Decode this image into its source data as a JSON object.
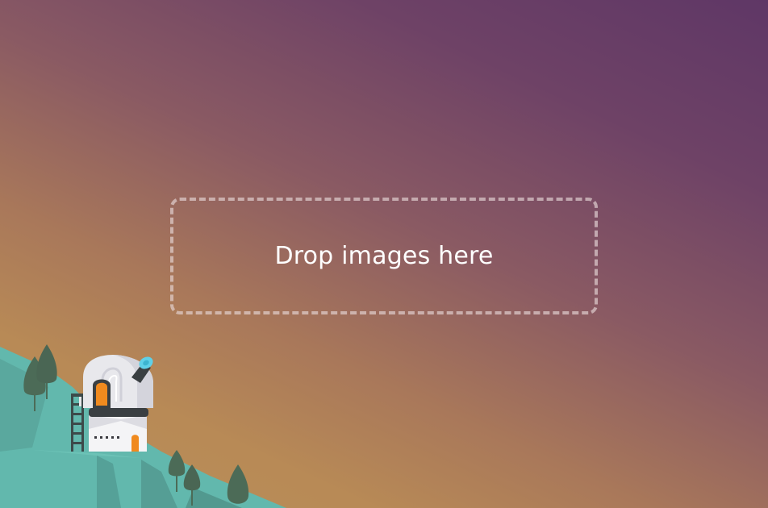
{
  "dropzone": {
    "label": "Drop images here"
  },
  "illustration": {
    "icons": [
      "hill",
      "observatory-icon",
      "telescope-icon",
      "tree-icon",
      "ladder-icon"
    ]
  },
  "colors": {
    "background_top": "#5f3766",
    "background_bottom": "#b88a56",
    "hill": "#5fb3a8",
    "hill_shadow": "#4e9c93",
    "tree": "#4c6b57",
    "observatory_dome": "#e6e6ea",
    "door": "#f08a1e",
    "telescope_lens": "#5fd0e8"
  }
}
